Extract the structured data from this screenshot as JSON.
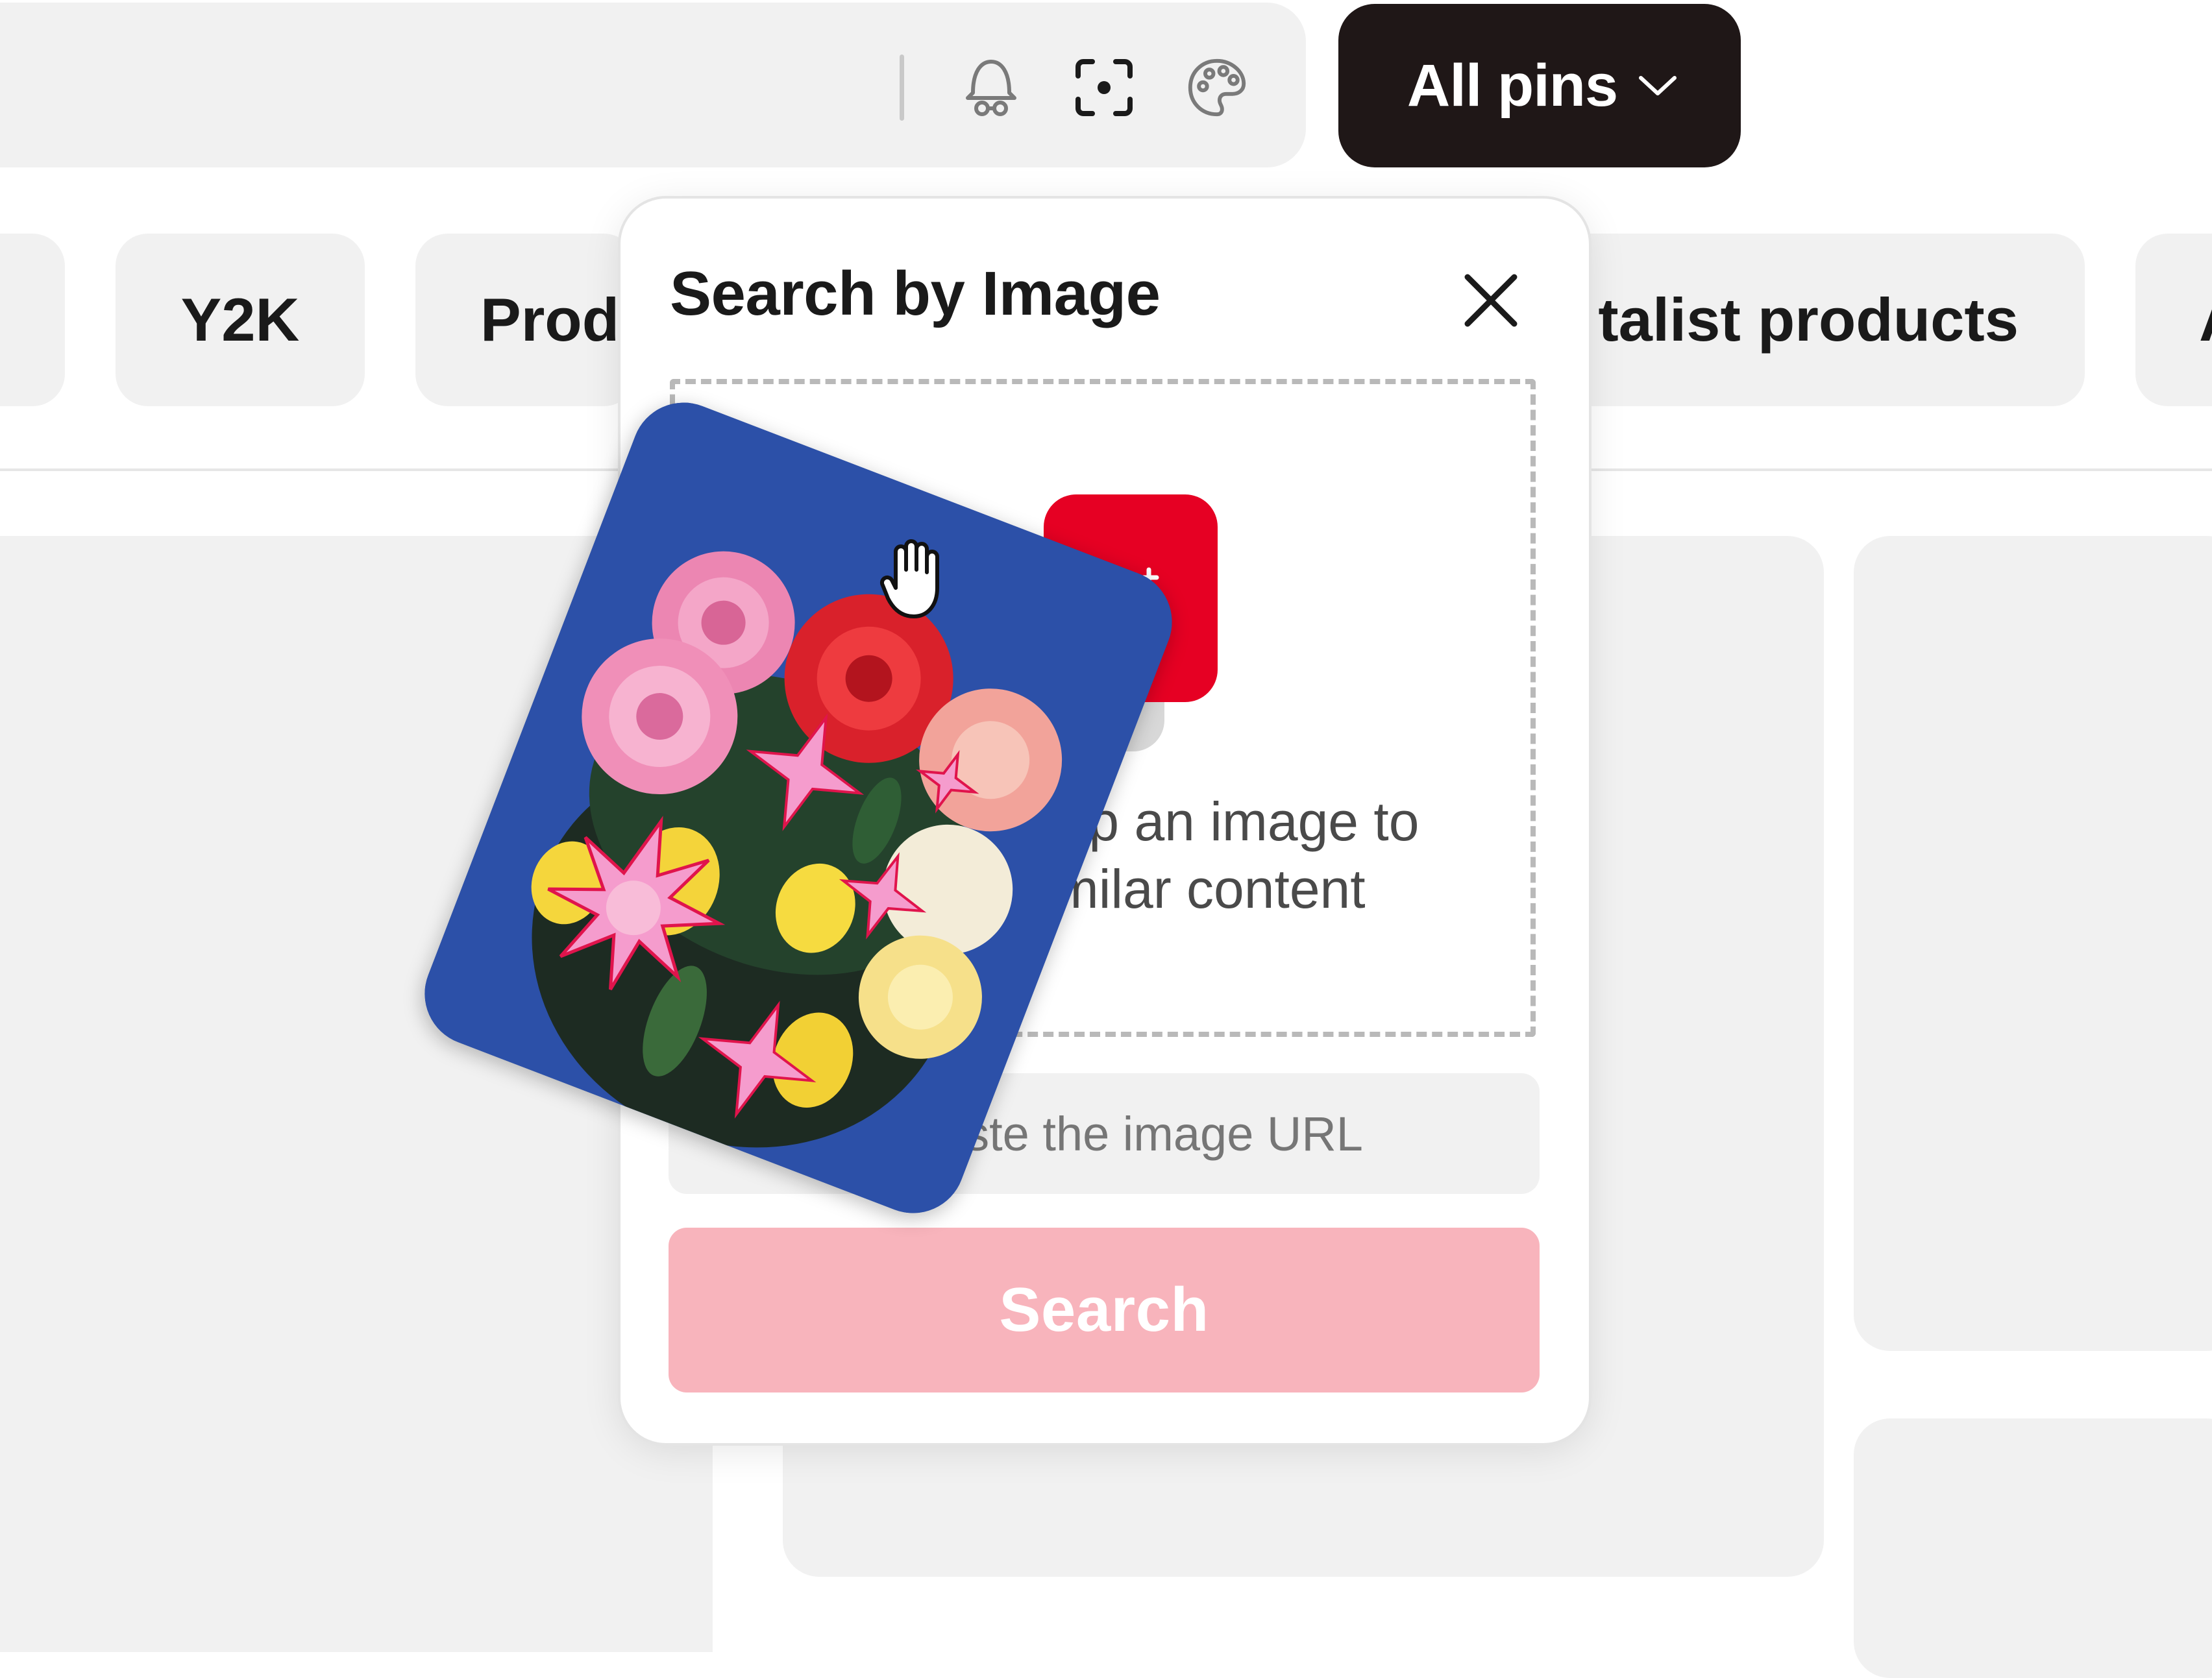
{
  "header": {
    "filter_button_label": "All pins",
    "icons": [
      "notification-bell-icon",
      "visual-search-icon",
      "color-palette-icon",
      "chevron-down-icon"
    ]
  },
  "chips": [
    "Y2K",
    "Prod",
    "talist products",
    "A"
  ],
  "dialog": {
    "title": "Search by Image",
    "drop_line1": "drop an image to",
    "drop_line2": "e similar content",
    "url_placeholder": "Or paste the image URL",
    "search_label": "Search",
    "icons": [
      "close-icon",
      "add-image-icon",
      "grab-cursor-icon"
    ]
  },
  "colors": {
    "accent": "#e60023",
    "search_disabled": "#f8b4bc",
    "dark_button": "#1f1717",
    "surface": "#f1f1f1"
  }
}
